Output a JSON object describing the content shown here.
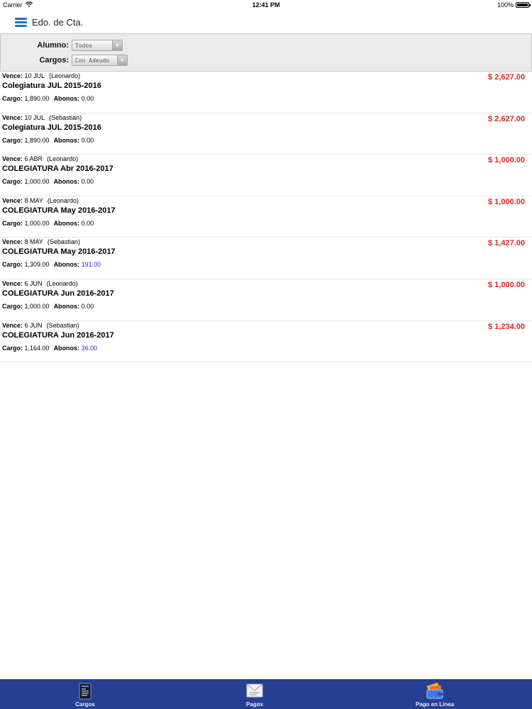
{
  "status_bar": {
    "carrier": "Carrier",
    "time": "12:41 PM",
    "battery": "100%"
  },
  "nav": {
    "title": "Edo. de Cta."
  },
  "filters": {
    "alumno_label": "Alumno:",
    "alumno_value": "Todos",
    "cargos_label": "Cargos:",
    "cargos_value": "Con Adeudo"
  },
  "items": [
    {
      "vence_label": "Vence:",
      "vence": "10 JUL",
      "alumno": "(Leonardo)",
      "concepto": "Colegiatura JUL 2015-2016",
      "cargo_label": "Cargo:",
      "cargo": "1,890.00",
      "abonos_label": "Abonos:",
      "abonos": "0.00",
      "amount": "$ 2,627.00"
    },
    {
      "vence_label": "Vence:",
      "vence": "10 JUL",
      "alumno": "(Sebastian)",
      "concepto": "Colegiatura JUL 2015-2016",
      "cargo_label": "Cargo:",
      "cargo": "1,890.00",
      "abonos_label": "Abonos:",
      "abonos": "0.00",
      "amount": "$ 2,627.00"
    },
    {
      "vence_label": "Vence:",
      "vence": "6 ABR",
      "alumno": "(Leonardo)",
      "concepto": "COLEGIATURA Abr 2016-2017",
      "cargo_label": "Cargo:",
      "cargo": "1,000.00",
      "abonos_label": "Abonos:",
      "abonos": "0.00",
      "amount": "$ 1,000.00"
    },
    {
      "vence_label": "Vence:",
      "vence": "8 MAY",
      "alumno": "(Leonardo)",
      "concepto": "COLEGIATURA May 2016-2017",
      "cargo_label": "Cargo:",
      "cargo": "1,000.00",
      "abonos_label": "Abonos:",
      "abonos": "0.00",
      "amount": "$ 1,000.00"
    },
    {
      "vence_label": "Vence:",
      "vence": "8 MAY",
      "alumno": "(Sebastian)",
      "concepto": "COLEGIATURA May 2016-2017",
      "cargo_label": "Cargo:",
      "cargo": "1,309.00",
      "abonos_label": "Abonos:",
      "abonos": "191.00",
      "amount": "$ 1,427.00"
    },
    {
      "vence_label": "Vence:",
      "vence": "6 JUN",
      "alumno": "(Leonardo)",
      "concepto": "COLEGIATURA Jun 2016-2017",
      "cargo_label": "Cargo:",
      "cargo": "1,000.00",
      "abonos_label": "Abonos:",
      "abonos": "0.00",
      "amount": "$ 1,000.00"
    },
    {
      "vence_label": "Vence:",
      "vence": "6 JUN",
      "alumno": "(Sebastian)",
      "concepto": "COLEGIATURA Jun 2016-2017",
      "cargo_label": "Cargo:",
      "cargo": "1,164.00",
      "abonos_label": "Abonos:",
      "abonos": "36.00",
      "amount": "$ 1,234.00"
    }
  ],
  "tabs": [
    {
      "label": "Cargos",
      "icon": "document-icon"
    },
    {
      "label": "Pagos",
      "icon": "envelope-icon"
    },
    {
      "label": "Pago en Linea",
      "icon": "wallet-card-icon"
    }
  ],
  "colors": {
    "accent_blue": "#2a6fc6",
    "amount_red": "#e0261f",
    "abono_blue": "#2424d8",
    "tab_bar": "#273f92"
  }
}
